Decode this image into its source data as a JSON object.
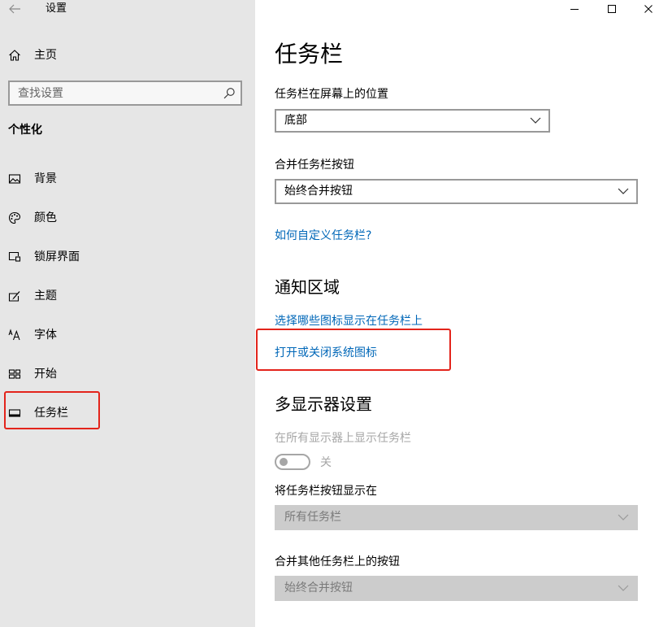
{
  "window": {
    "title": "设置",
    "controls": {
      "minimize_icon": "minimize-icon",
      "maximize_icon": "maximize-icon",
      "close_icon": "close-icon"
    }
  },
  "sidebar": {
    "back_icon": "back-arrow-icon",
    "home": {
      "label": "主页",
      "icon": "home-icon"
    },
    "search": {
      "placeholder": "查找设置",
      "icon": "search-icon"
    },
    "section_title": "个性化",
    "items": [
      {
        "label": "背景",
        "icon": "picture-icon"
      },
      {
        "label": "颜色",
        "icon": "palette-icon"
      },
      {
        "label": "锁屏界面",
        "icon": "lockscreen-icon"
      },
      {
        "label": "主题",
        "icon": "theme-icon"
      },
      {
        "label": "字体",
        "icon": "font-icon"
      },
      {
        "label": "开始",
        "icon": "start-icon"
      },
      {
        "label": "任务栏",
        "icon": "taskbar-icon",
        "highlighted": true
      }
    ]
  },
  "main": {
    "title": "任务栏",
    "position": {
      "label": "任务栏在屏幕上的位置",
      "value": "底部"
    },
    "combine": {
      "label": "合并任务栏按钮",
      "value": "始终合并按钮"
    },
    "customize_link": "如何自定义任务栏?",
    "notification_area": {
      "heading": "通知区域",
      "links": [
        "选择哪些图标显示在任务栏上",
        "打开或关闭系统图标"
      ],
      "highlighted_link_index": 1
    },
    "multi_display": {
      "heading": "多显示器设置",
      "show_on_all": {
        "label": "在所有显示器上显示任务栏",
        "state_label": "关",
        "on": false,
        "disabled": true
      },
      "show_buttons_on": {
        "label": "将任务栏按钮显示在",
        "value": "所有任务栏",
        "disabled": true
      },
      "combine_other": {
        "label": "合并其他任务栏上的按钮",
        "value": "始终合并按钮",
        "disabled": true
      }
    }
  },
  "colors": {
    "sidebar_bg": "#e6e6e6",
    "main_bg": "#ffffff",
    "text": "#000000",
    "link": "#0067b8",
    "border": "#999999",
    "disabled_text": "#a6a6a6",
    "disabled_fill": "#cccccc",
    "annotation": "#e3241b"
  }
}
